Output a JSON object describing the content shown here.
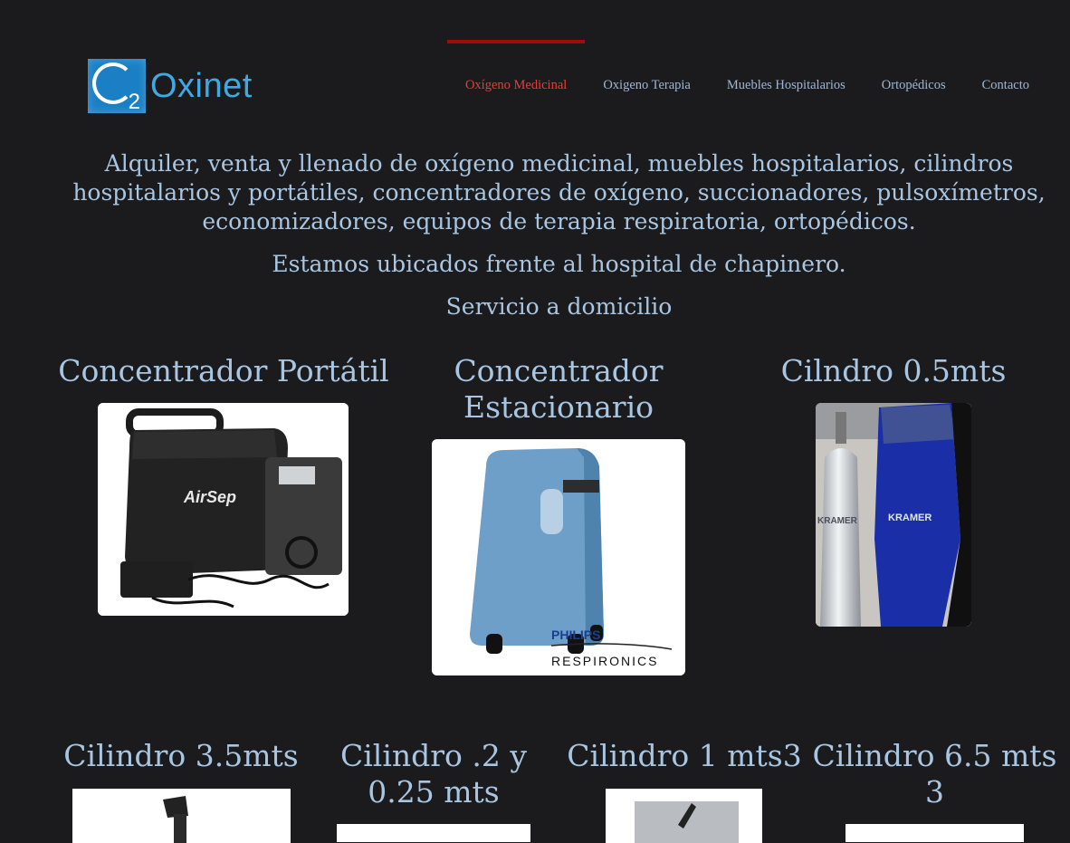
{
  "brand": {
    "logo_sub": "2",
    "name": "Oxinet"
  },
  "nav": [
    {
      "label": "Oxígeno Medicinal",
      "active": true
    },
    {
      "label": "Oxigeno Terapia",
      "active": false
    },
    {
      "label": "Muebles Hospitalarios",
      "active": false
    },
    {
      "label": "Ortopédicos",
      "active": false
    },
    {
      "label": "Contacto",
      "active": false
    }
  ],
  "intro": {
    "p1": "Alquiler, venta y llenado de oxígeno medicinal, muebles hospitalarios, cilindros hospitalarios y portátiles, concentradores de oxígeno, succionadores, pulsoxímetros, economizadores, equipos de terapia respiratoria, ortopédicos.",
    "p2": "Estamos ubicados frente al hospital de chapinero.",
    "p3": "Servicio a domicilio"
  },
  "products_row1": [
    {
      "title": "Concentrador Portátil",
      "image_text": "AirSep"
    },
    {
      "title": "Concentrador Estacionario",
      "image_text": [
        "PHILIPS",
        "RESPIRONICS"
      ]
    },
    {
      "title": "Cilndro 0.5mts",
      "image_text": [
        "KRAMER",
        "KRAMER"
      ]
    }
  ],
  "products_row2": [
    {
      "title": "Cilindro 3.5mts"
    },
    {
      "title": "Cilindro .2 y 0.25 mts"
    },
    {
      "title": "Cilindro 1 mts3"
    },
    {
      "title": "Cilindro 6.5 mts 3"
    }
  ],
  "colors": {
    "background": "#1b1b1e",
    "accent": "#a00c0c",
    "active_link": "#e0403a",
    "text": "#a8c6e2",
    "logo": "#3fa9e0"
  }
}
